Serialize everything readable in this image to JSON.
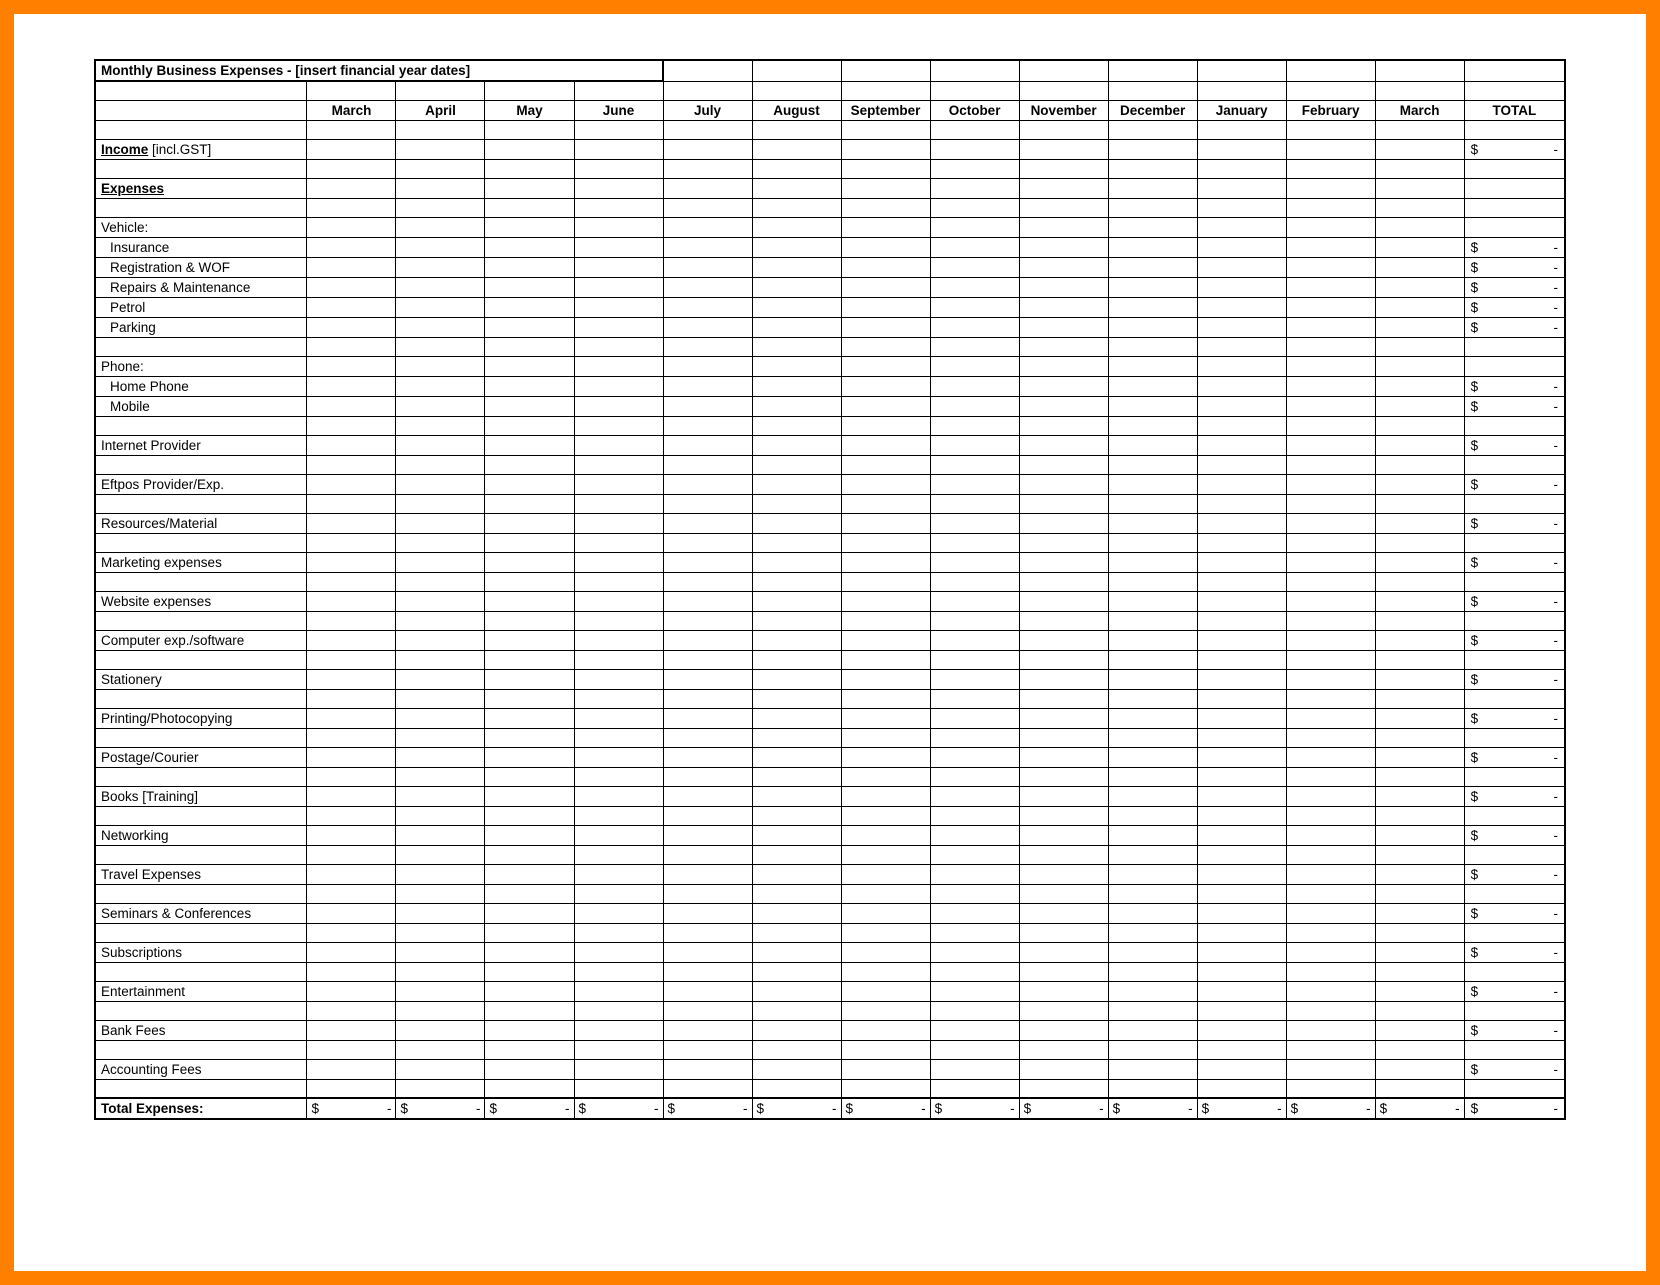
{
  "title": "Monthly Business Expenses - [insert financial year dates]",
  "months": [
    "March",
    "April",
    "May",
    "June",
    "July",
    "August",
    "September",
    "October",
    "November",
    "December",
    "January",
    "February",
    "March"
  ],
  "total_header": "TOTAL",
  "currency": "$",
  "dash": "-",
  "rows": [
    {
      "type": "blank"
    },
    {
      "type": "line",
      "label_html": "<span class='underline-text'>Income</span> [incl.GST]",
      "total": true
    },
    {
      "type": "blank"
    },
    {
      "type": "line",
      "label": "Expenses",
      "bold": true,
      "underline": true,
      "total": false
    },
    {
      "type": "blank"
    },
    {
      "type": "line",
      "label": "Vehicle:",
      "total": false
    },
    {
      "type": "line",
      "label": "Insurance",
      "indent": true,
      "total": true
    },
    {
      "type": "line",
      "label": "Registration & WOF",
      "indent": true,
      "total": true
    },
    {
      "type": "line",
      "label": "Repairs & Maintenance",
      "indent": true,
      "total": true
    },
    {
      "type": "line",
      "label": "Petrol",
      "indent": true,
      "total": true
    },
    {
      "type": "line",
      "label": "Parking",
      "indent": true,
      "total": true
    },
    {
      "type": "blank"
    },
    {
      "type": "line",
      "label": "Phone:",
      "total": false
    },
    {
      "type": "line",
      "label": "Home Phone",
      "indent": true,
      "total": true
    },
    {
      "type": "line",
      "label": "Mobile",
      "indent": true,
      "total": true
    },
    {
      "type": "blank"
    },
    {
      "type": "line",
      "label": "Internet Provider",
      "total": true
    },
    {
      "type": "blank"
    },
    {
      "type": "line",
      "label": "Eftpos Provider/Exp.",
      "total": true
    },
    {
      "type": "blank"
    },
    {
      "type": "line",
      "label": "Resources/Material",
      "total": true
    },
    {
      "type": "blank"
    },
    {
      "type": "line",
      "label": "Marketing expenses",
      "total": true
    },
    {
      "type": "blank"
    },
    {
      "type": "line",
      "label": "Website expenses",
      "total": true
    },
    {
      "type": "blank"
    },
    {
      "type": "line",
      "label": "Computer exp./software",
      "total": true
    },
    {
      "type": "blank"
    },
    {
      "type": "line",
      "label": "Stationery",
      "total": true
    },
    {
      "type": "blank"
    },
    {
      "type": "line",
      "label": "Printing/Photocopying",
      "total": true
    },
    {
      "type": "blank"
    },
    {
      "type": "line",
      "label": "Postage/Courier",
      "total": true
    },
    {
      "type": "blank"
    },
    {
      "type": "line",
      "label": "Books [Training]",
      "total": true
    },
    {
      "type": "blank"
    },
    {
      "type": "line",
      "label": "Networking",
      "total": true
    },
    {
      "type": "blank"
    },
    {
      "type": "line",
      "label": "Travel Expenses",
      "total": true
    },
    {
      "type": "blank"
    },
    {
      "type": "line",
      "label": "Seminars & Conferences",
      "total": true
    },
    {
      "type": "blank"
    },
    {
      "type": "line",
      "label": "Subscriptions",
      "total": true
    },
    {
      "type": "blank"
    },
    {
      "type": "line",
      "label": "Entertainment",
      "total": true
    },
    {
      "type": "blank"
    },
    {
      "type": "line",
      "label": "Bank Fees",
      "total": true
    },
    {
      "type": "blank"
    },
    {
      "type": "line",
      "label": "Accounting Fees",
      "total": true
    },
    {
      "type": "blank"
    }
  ],
  "total_row_label": "Total Expenses:"
}
